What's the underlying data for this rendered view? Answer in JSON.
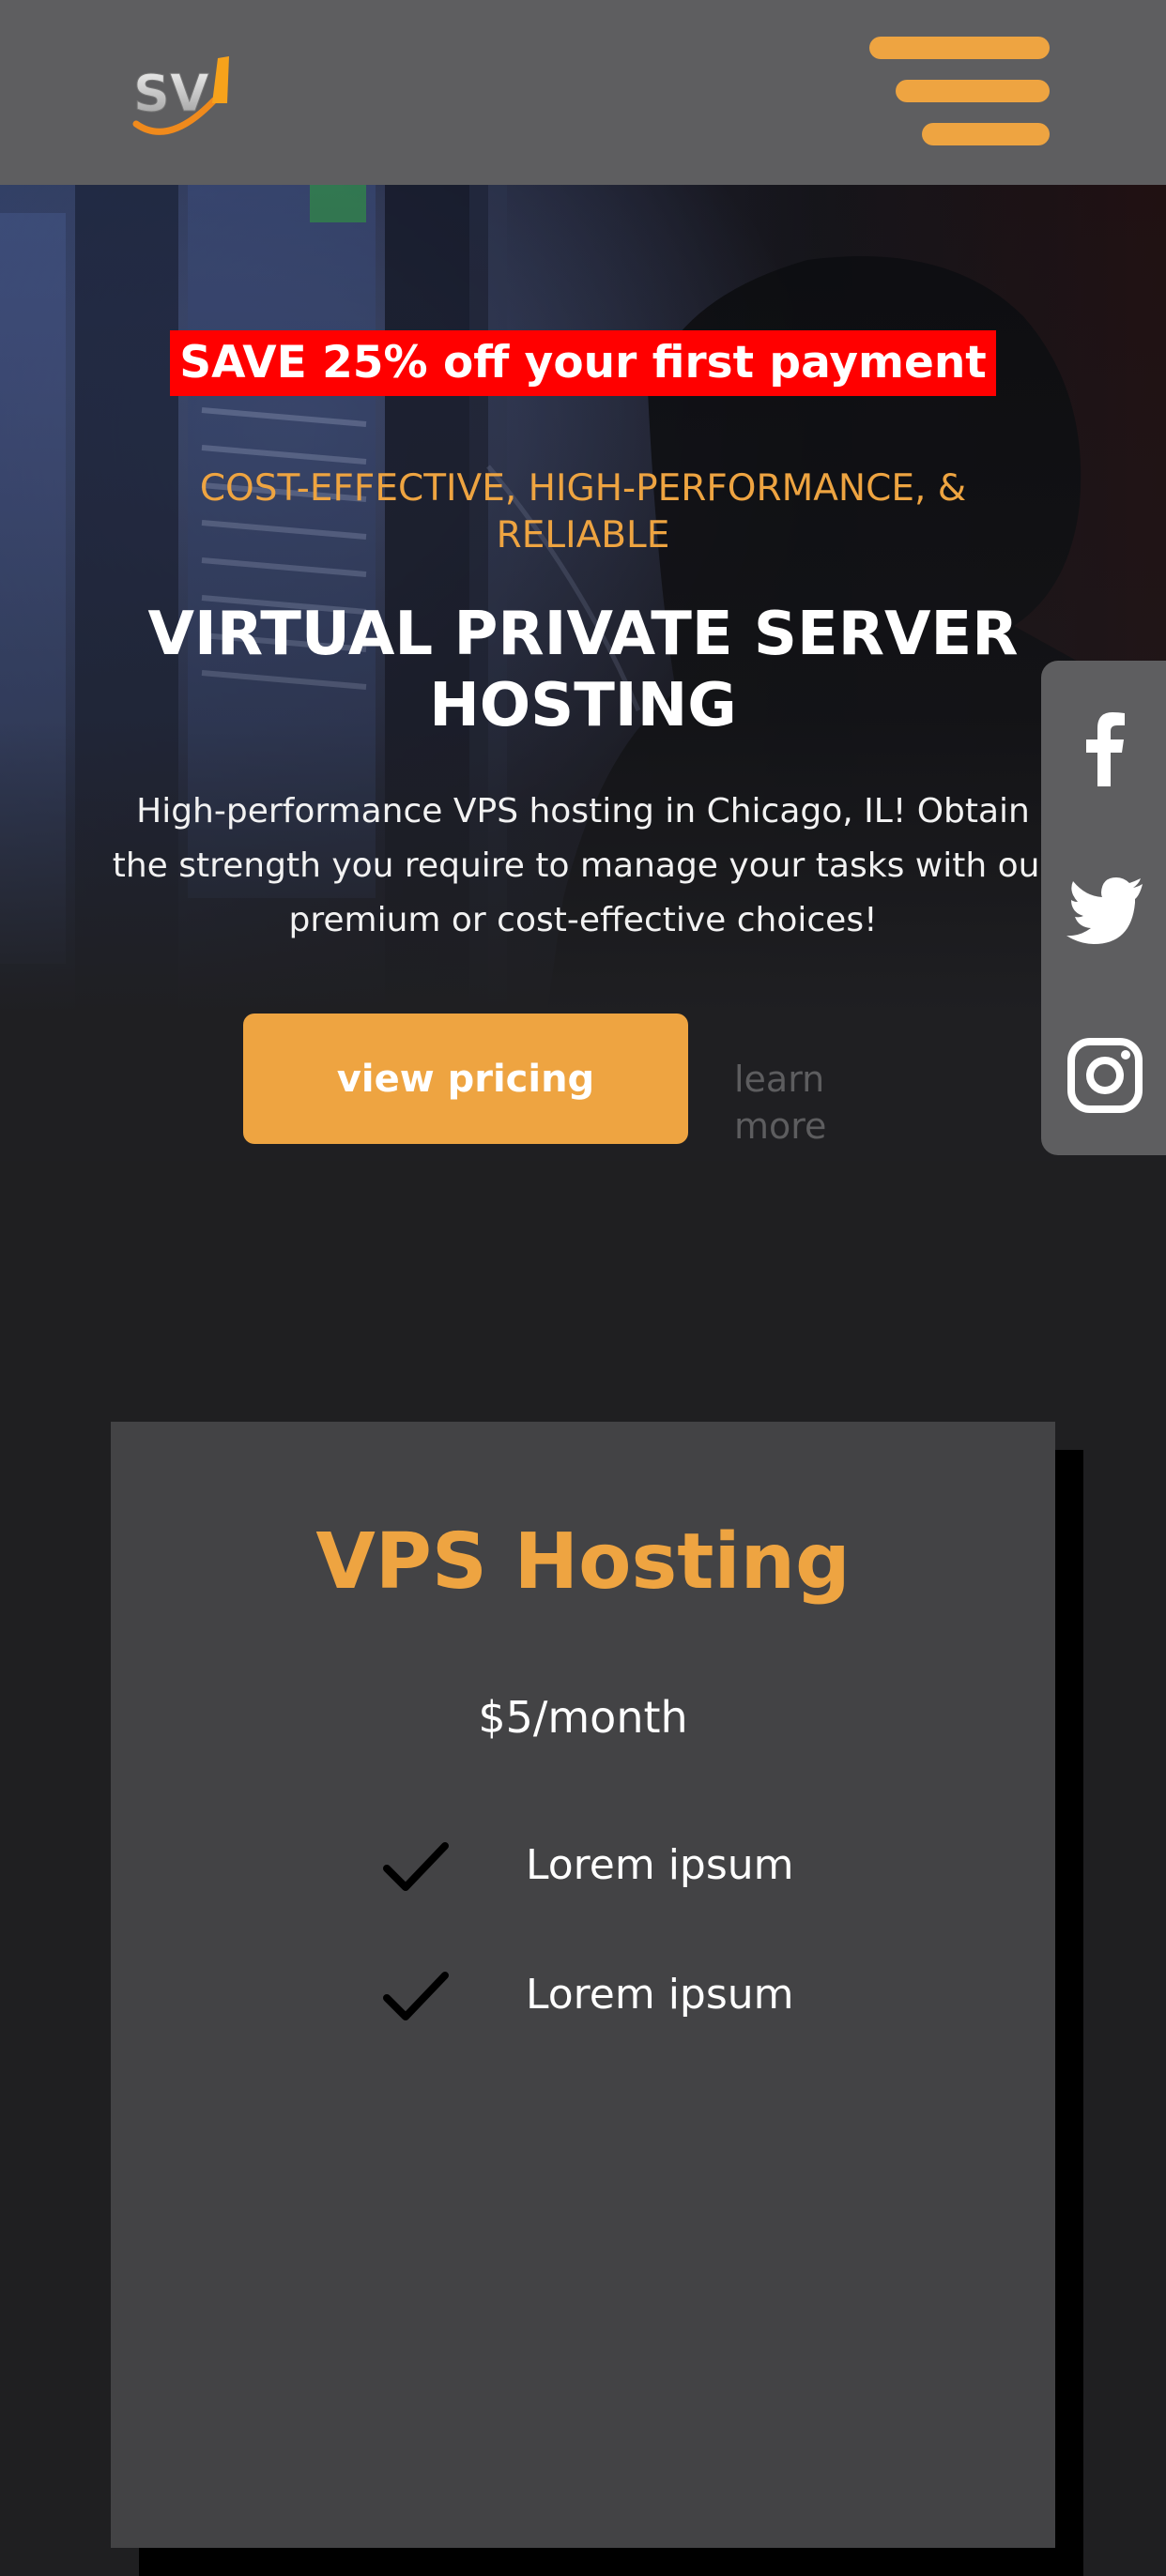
{
  "header": {
    "logo_text": "SV",
    "menu_icon": "hamburger-menu-icon",
    "accent_color": "#eea441"
  },
  "hero": {
    "promo": "SAVE 25% off your first payment",
    "tagline": "COST-EFFECTIVE, HIGH-PERFORMANCE, & RELIABLE",
    "title": "VIRTUAL PRIVATE SERVER HOSTING",
    "description": "High-performance VPS hosting in Chicago, IL! Obtain the strength you require to manage your tasks with our premium or cost-effective choices!",
    "primary_button": "view pricing",
    "secondary_link": "learn more"
  },
  "social": {
    "icons": [
      "facebook-icon",
      "twitter-icon",
      "instagram-icon"
    ]
  },
  "pricing_card": {
    "title": "VPS Hosting",
    "price": "$5/month",
    "features": [
      "Lorem ipsum",
      "Lorem ipsum"
    ]
  }
}
